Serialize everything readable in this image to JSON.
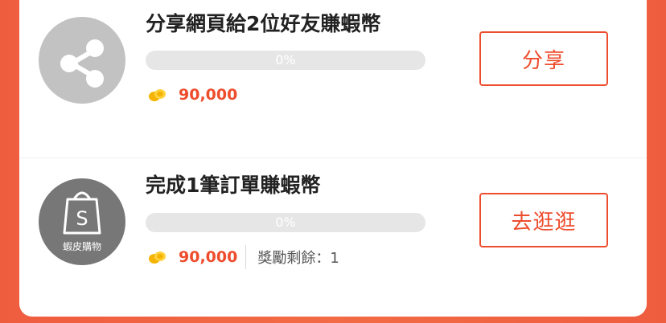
{
  "tasks": [
    {
      "title": "分享網頁給2位好友賺蝦幣",
      "progress_percent": 0,
      "progress_label": "0%",
      "reward_amount": "90,000",
      "button_label": "分享",
      "icon": "share-icon"
    },
    {
      "title": "完成1筆訂單賺蝦幣",
      "progress_percent": 0,
      "progress_label": "0%",
      "reward_amount": "90,000",
      "remaining_label": "獎勵剩餘：1",
      "button_label": "去逛逛",
      "icon": "shopee-bag-icon",
      "icon_caption": "蝦皮購物"
    }
  ],
  "colors": {
    "brand": "#ee4d2d",
    "page_background": "#f06244",
    "progress_track": "#e6e6e6"
  }
}
